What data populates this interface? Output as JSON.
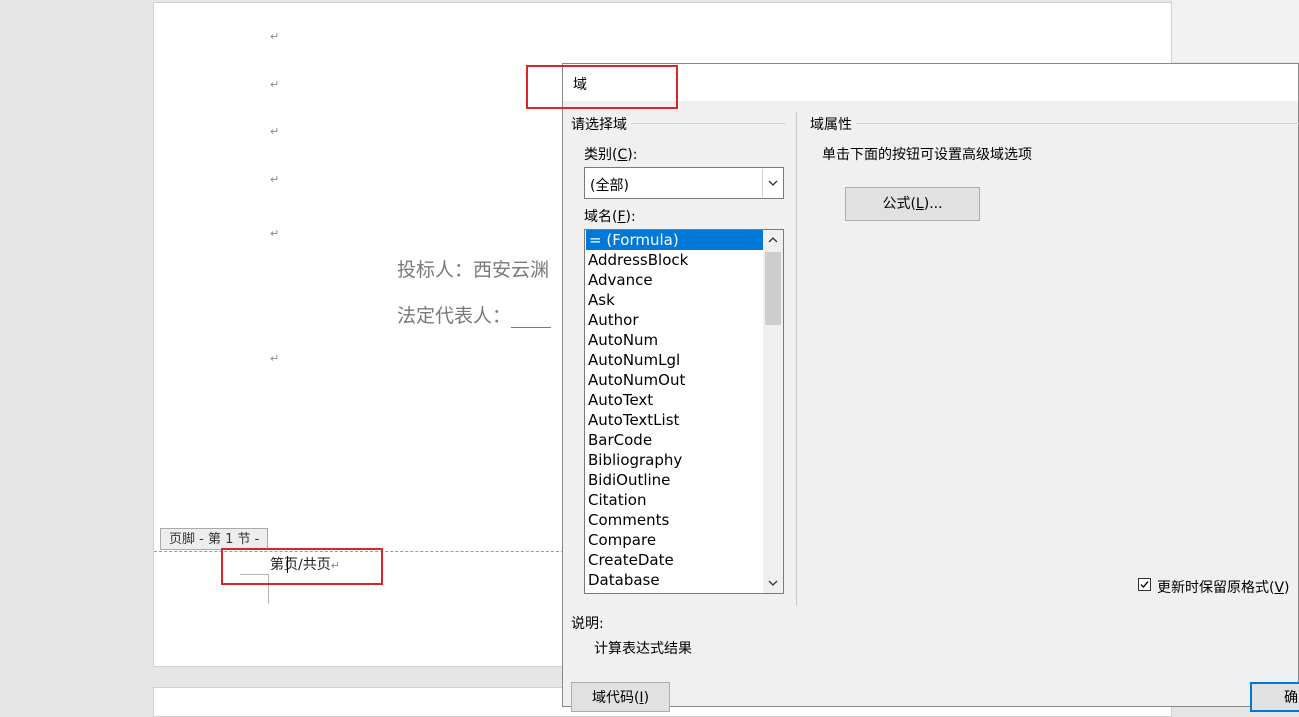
{
  "document": {
    "paragraph_mark": "↵",
    "bidder_line": "投标人：西安云渊",
    "legal_rep_line": "法定代表人：",
    "footer_tag": "页脚 - 第 1 节 -",
    "footer_text": "第页/共页"
  },
  "dialog": {
    "title": "域",
    "choose_field_group": "请选择域",
    "category_label": "类别(",
    "category_hotkey": "C",
    "category_label_end": "):",
    "category_value": "(全部)",
    "field_names_label": "域名(",
    "field_names_hotkey": "F",
    "field_names_label_end": "):",
    "field_names": [
      "= (Formula)",
      "AddressBlock",
      "Advance",
      "Ask",
      "Author",
      "AutoNum",
      "AutoNumLgl",
      "AutoNumOut",
      "AutoText",
      "AutoTextList",
      "BarCode",
      "Bibliography",
      "BidiOutline",
      "Citation",
      "Comments",
      "Compare",
      "CreateDate",
      "Database"
    ],
    "selected_field": "= (Formula)",
    "field_properties_group": "域属性",
    "properties_hint": "单击下面的按钮可设置高级域选项",
    "formula_button": "公式(",
    "formula_hotkey": "L",
    "formula_button_end": ")...",
    "preserve_format_label": "更新时保留原格式(",
    "preserve_format_hotkey": "V",
    "preserve_format_end": ")",
    "preserve_format_checked": true,
    "description_label": "说明:",
    "description_text": "计算表达式结果",
    "field_codes_button": "域代码(",
    "field_codes_hotkey": "I",
    "field_codes_end": ")",
    "ok_button": "确"
  },
  "colors": {
    "selection": "#0078d7",
    "highlight_box": "#d9262b",
    "dialog_bg": "#f0f0f0"
  }
}
